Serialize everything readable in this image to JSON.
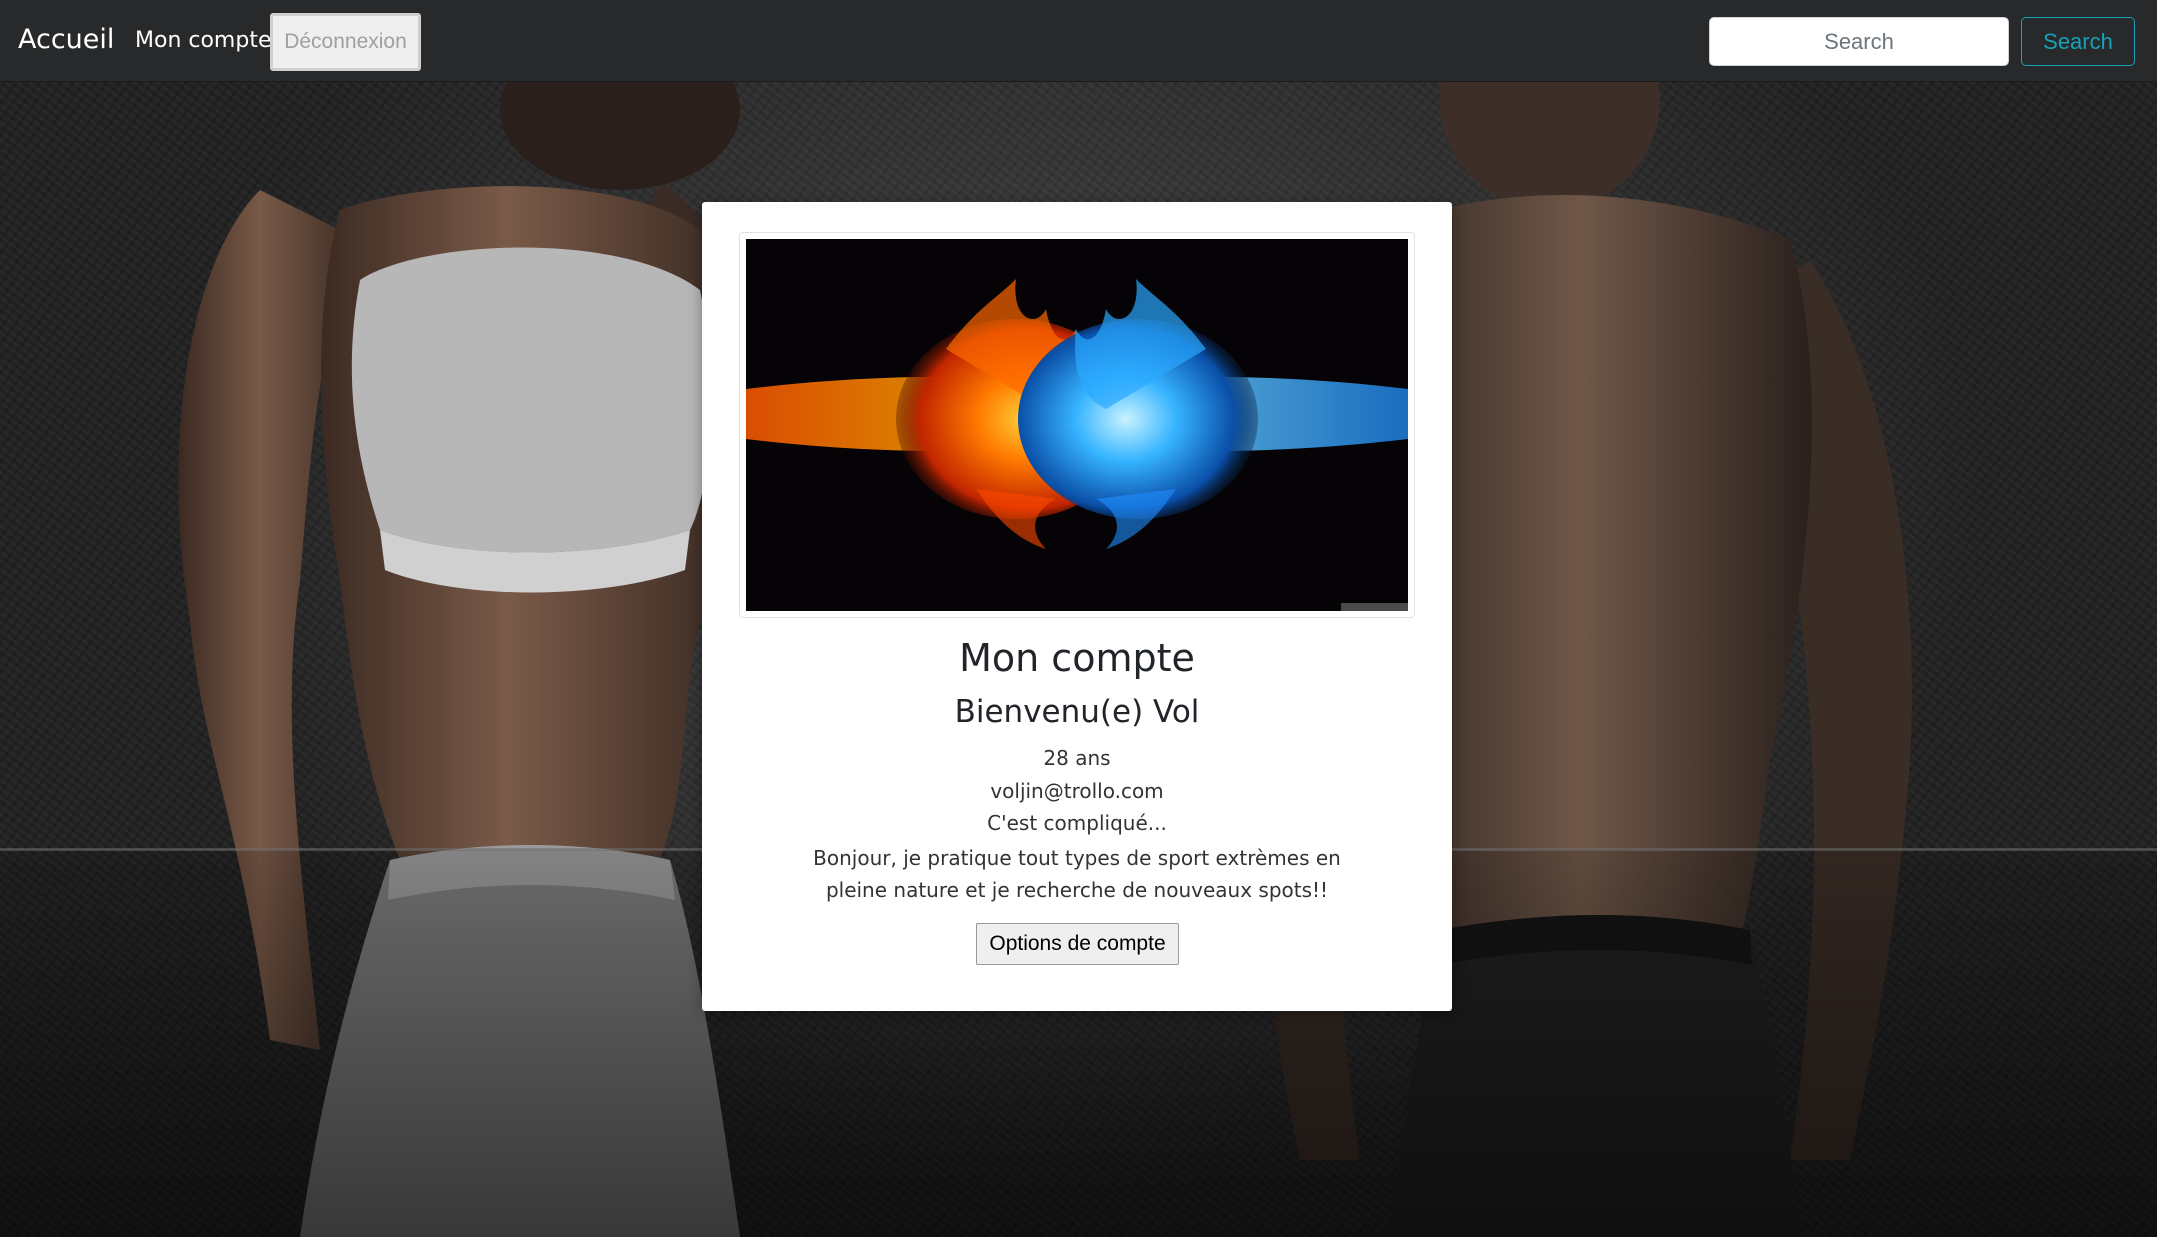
{
  "nav": {
    "brand": "Accueil",
    "account_link": "Mon compte",
    "logout_button": "Déconnexion",
    "search_placeholder": "Search",
    "search_button": "Search"
  },
  "profile": {
    "title": "Mon compte",
    "welcome": "Bienvenu(e) Vol",
    "age": "28 ans",
    "email": "voljin@trollo.com",
    "relationship": "C'est compliqué...",
    "bio": "Bonjour, je pratique tout types de sport extrèmes en pleine nature et je recherche de nouveaux spots!!",
    "options_button": "Options de compte"
  },
  "images": {
    "background": "gym-athletes-background",
    "banner": "fire-and-ice-fists"
  },
  "colors": {
    "navbar_bg": "#27292b",
    "search_accent": "#17a2b8",
    "fire": "#ff6a00",
    "ice": "#29a8ff"
  }
}
